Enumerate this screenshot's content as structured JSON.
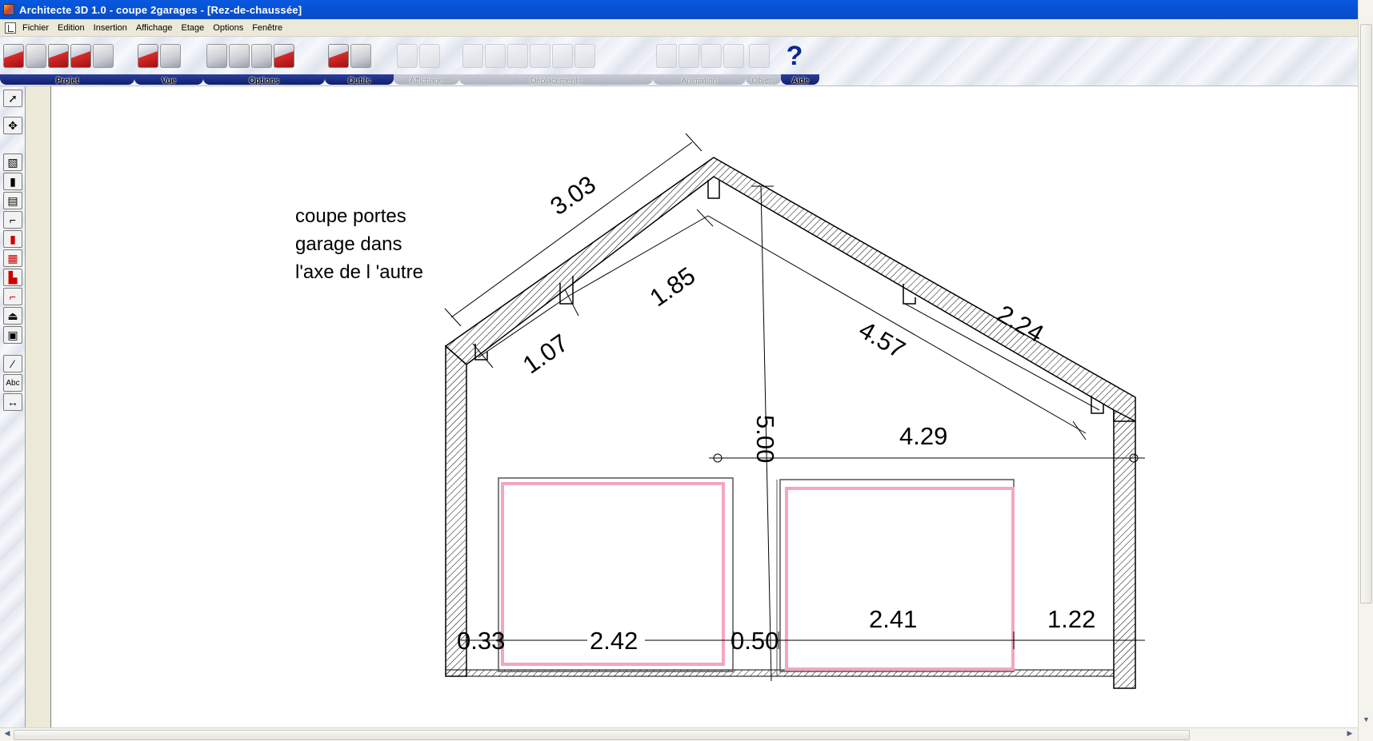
{
  "window": {
    "title": "Architecte 3D  1.0 - coupe 2garages - [Rez-de-chaussée]"
  },
  "menu": {
    "items": [
      "Fichier",
      "Edition",
      "Insertion",
      "Affichage",
      "Etage",
      "Options",
      "Fenêtre"
    ]
  },
  "toolbar": {
    "groups": [
      {
        "label": "Projet",
        "enabled": true
      },
      {
        "label": "Vue",
        "enabled": true
      },
      {
        "label": "Options",
        "enabled": true
      },
      {
        "label": "Outils",
        "enabled": true
      },
      {
        "label": "Affichage",
        "enabled": false
      },
      {
        "label": "Déplacements",
        "enabled": false
      },
      {
        "label": "Animation",
        "enabled": false
      },
      {
        "label": "Objets",
        "enabled": false
      },
      {
        "label": "Aide",
        "enabled": true
      }
    ],
    "help_glyph": "?"
  },
  "palette": {
    "text_tool_label": "Abc",
    "dimension_tool_label": "↔"
  },
  "drawing": {
    "note_lines": [
      "coupe portes",
      "garage dans",
      "l'axe de l 'autre"
    ],
    "dimensions": {
      "roof_left_outer": "3.03",
      "roof_left_upper": "1.85",
      "roof_left_lower": "1.07",
      "roof_right_lower": "4.57",
      "roof_right_upper": "2.24",
      "height": "5.00",
      "horizontal_upper": "4.29",
      "wall_left": "0.33",
      "door_left": "2.42",
      "pillar": "0.50",
      "door_right": "2.41",
      "wall_right": "1.22"
    },
    "colors": {
      "door_outline": "#f4a6c0",
      "lines": "#000000"
    }
  }
}
